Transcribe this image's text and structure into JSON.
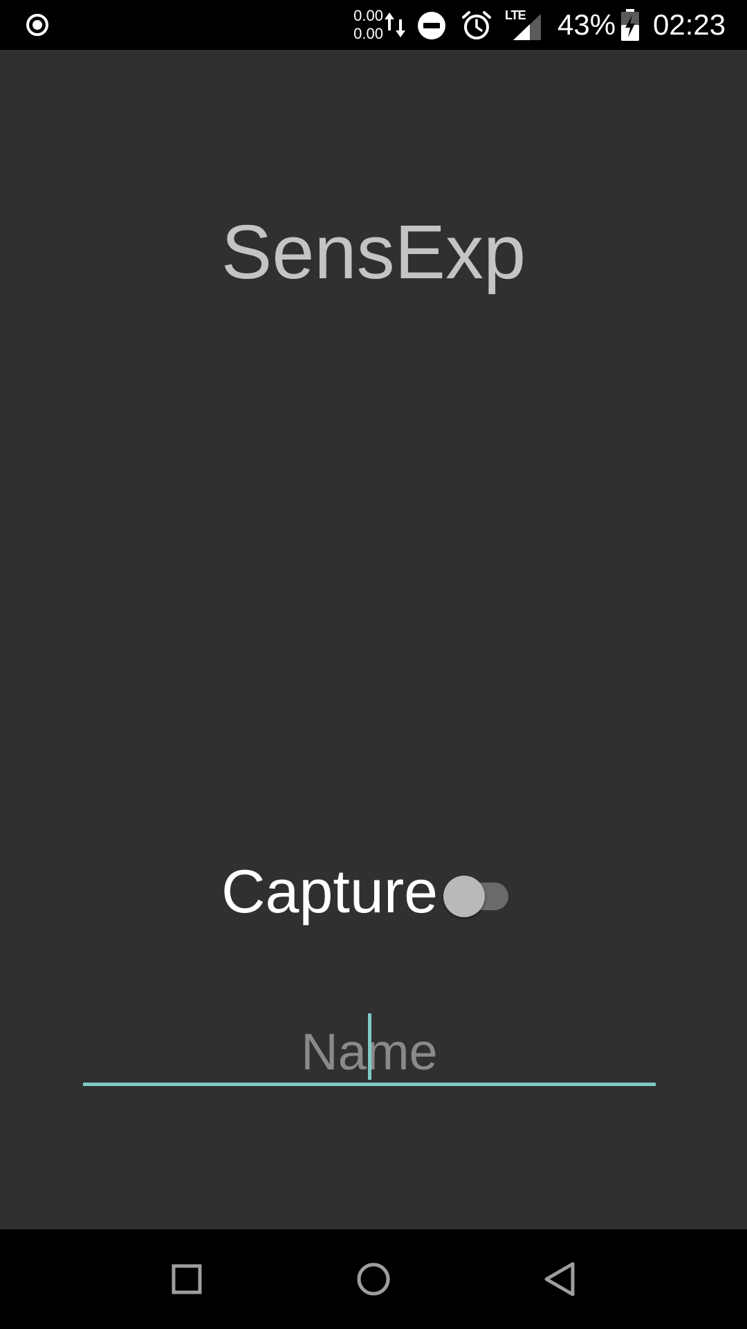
{
  "status_bar": {
    "left_icon": "target-ring-icon",
    "net_up": "0.00",
    "net_down": "0.00",
    "data_icon": "data-arrows-icon",
    "dnd_icon": "do-not-disturb-icon",
    "alarm_icon": "alarm-clock-icon",
    "signal_label": "LTE",
    "battery_percent": "43%",
    "battery_icon": "battery-charging-icon",
    "clock": "02:23"
  },
  "main": {
    "title": "SensExp",
    "capture": {
      "label": "Capture",
      "switch_on": false
    },
    "name_field": {
      "placeholder": "Name",
      "value": ""
    }
  },
  "nav_bar": {
    "recents_icon": "square-recents-icon",
    "home_icon": "circle-home-icon",
    "back_icon": "triangle-back-icon"
  },
  "colors": {
    "background": "#303030",
    "accent": "#80cbc4",
    "title_text": "#c4c4c4",
    "bars": "#000000"
  }
}
